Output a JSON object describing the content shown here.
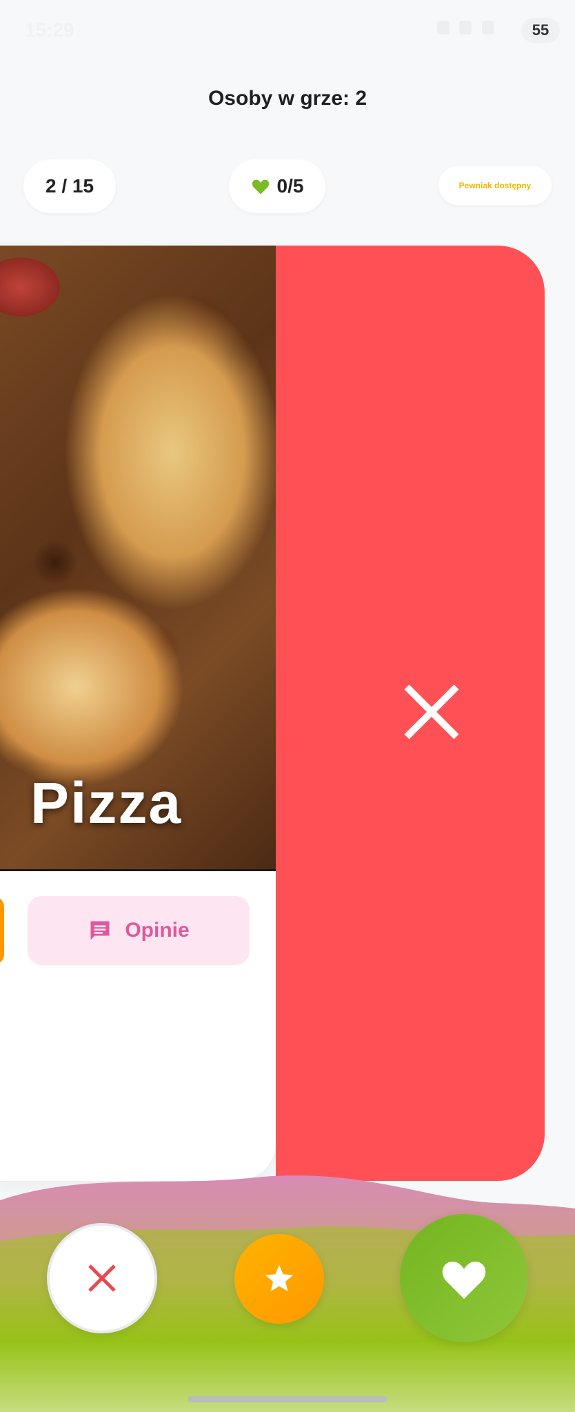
{
  "status": {
    "time": "15:29",
    "battery": "55"
  },
  "header": {
    "title": "Osoby w grze: 2"
  },
  "stats": {
    "counter": "2 / 15",
    "likes": "0/5",
    "hint": "Pewniak dostępny"
  },
  "card": {
    "dish_name": "Pizza",
    "reviews_label": "Opinie"
  },
  "colors": {
    "reject": "#ff5155",
    "like": "#7cbb28",
    "super": "#ffa000",
    "hint": "#f3b400",
    "reviews": "#e2579b"
  },
  "icons": {
    "likes": "heart-icon",
    "reviews": "comment-icon",
    "reject": "close-icon",
    "dislike": "close-icon",
    "super": "star-icon",
    "like": "heart-icon"
  }
}
